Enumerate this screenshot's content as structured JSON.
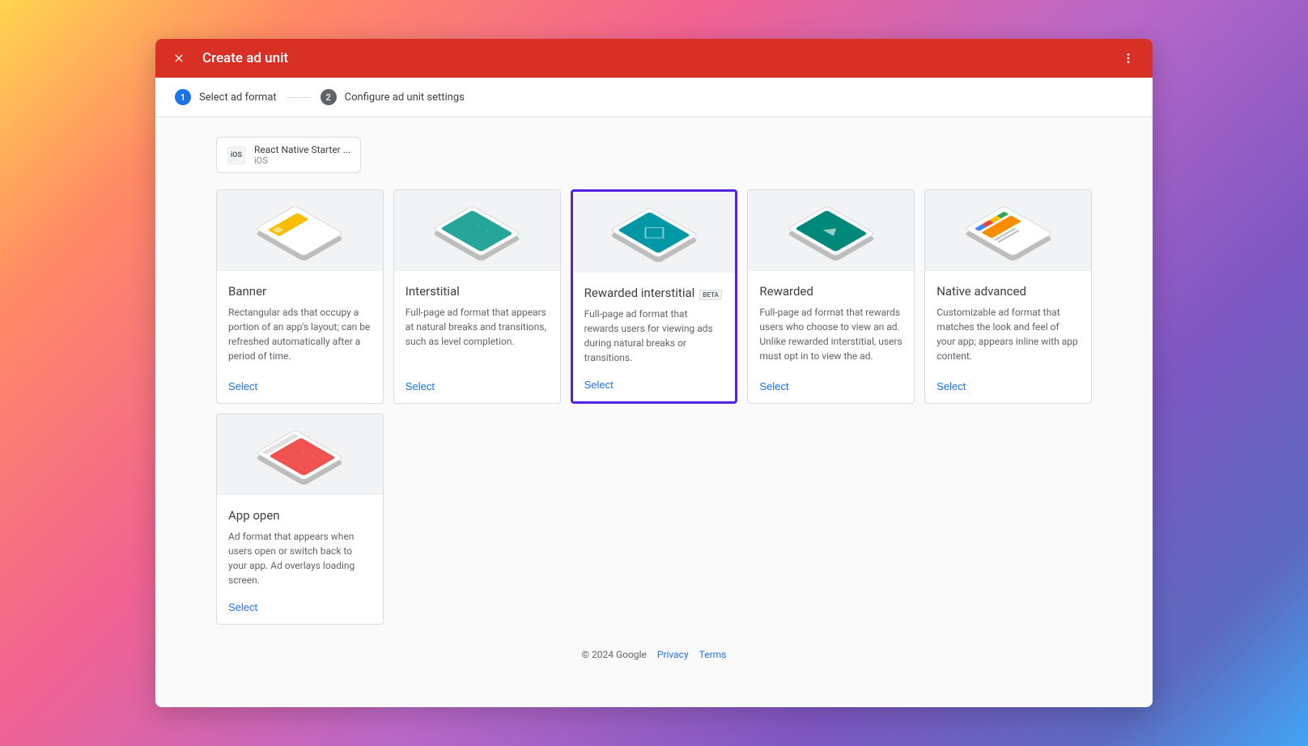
{
  "header": {
    "title": "Create ad unit"
  },
  "stepper": {
    "step1": {
      "num": "1",
      "label": "Select ad format"
    },
    "step2": {
      "num": "2",
      "label": "Configure ad unit settings"
    }
  },
  "app": {
    "name": "React Native Starter ...",
    "platform": "iOS",
    "icon_text": "iOS"
  },
  "cards": {
    "banner": {
      "title": "Banner",
      "desc": "Rectangular ads that occupy a portion of an app's layout; can be refreshed automatically after a period of time.",
      "action": "Select"
    },
    "interstitial": {
      "title": "Interstitial",
      "desc": "Full-page ad format that appears at natural breaks and transitions, such as level completion.",
      "action": "Select"
    },
    "rewarded_interstitial": {
      "title": "Rewarded interstitial",
      "badge": "BETA",
      "desc": "Full-page ad format that rewards users for viewing ads during natural breaks or transitions.",
      "action": "Select"
    },
    "rewarded": {
      "title": "Rewarded",
      "desc": "Full-page ad format that rewards users who choose to view an ad. Unlike rewarded interstitial, users must opt in to view the ad.",
      "action": "Select"
    },
    "native": {
      "title": "Native advanced",
      "desc": "Customizable ad format that matches the look and feel of your app; appears inline with app content.",
      "action": "Select"
    },
    "appopen": {
      "title": "App open",
      "desc": "Ad format that appears when users open or switch back to your app. Ad overlays loading screen.",
      "action": "Select"
    }
  },
  "footer": {
    "copyright": "© 2024 Google",
    "privacy": "Privacy",
    "terms": "Terms"
  }
}
